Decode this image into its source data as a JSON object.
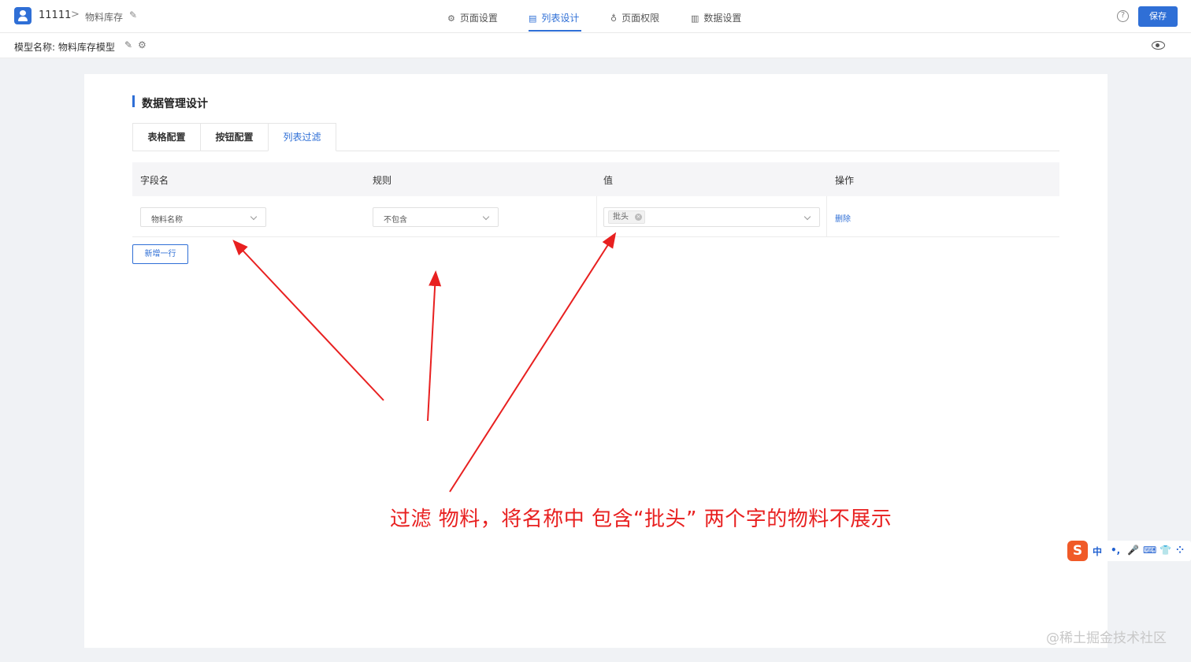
{
  "header": {
    "app_name": "11111",
    "breadcrumb_separator": ">",
    "page_name": "物料库存",
    "nav": [
      {
        "icon": "gear-icon",
        "label": "页面设置"
      },
      {
        "icon": "list-design-icon",
        "label": "列表设计",
        "active": true
      },
      {
        "icon": "lock-icon",
        "label": "页面权限"
      },
      {
        "icon": "bar-chart-icon",
        "label": "数据设置"
      }
    ],
    "help_icon": "?",
    "save_label": "保存",
    "accent_color": "#2f6fd6"
  },
  "subheader": {
    "model_label": "模型名称: 物料库存模型"
  },
  "main": {
    "section_title": "数据管理设计",
    "tabs": [
      {
        "label": "表格配置"
      },
      {
        "label": "按钮配置"
      },
      {
        "label": "列表过滤",
        "active": true
      }
    ],
    "table": {
      "headers": {
        "field": "字段名",
        "rule": "规则",
        "value": "值",
        "action": "操作"
      },
      "rows": [
        {
          "field": "物料名称",
          "rule": "不包含",
          "value_tags": [
            "批头"
          ],
          "action": "删除"
        }
      ]
    },
    "add_row_label": "新增一行"
  },
  "annotation": {
    "text": "过滤 物料，将名称中 包含“批头” 两个字的物料不展示",
    "color": "#e82020"
  },
  "ime": {
    "logo": "S",
    "items": [
      "中",
      "•,",
      "🎤",
      "⌨",
      "👕",
      "⁘"
    ]
  },
  "watermark": "@稀土掘金技术社区"
}
